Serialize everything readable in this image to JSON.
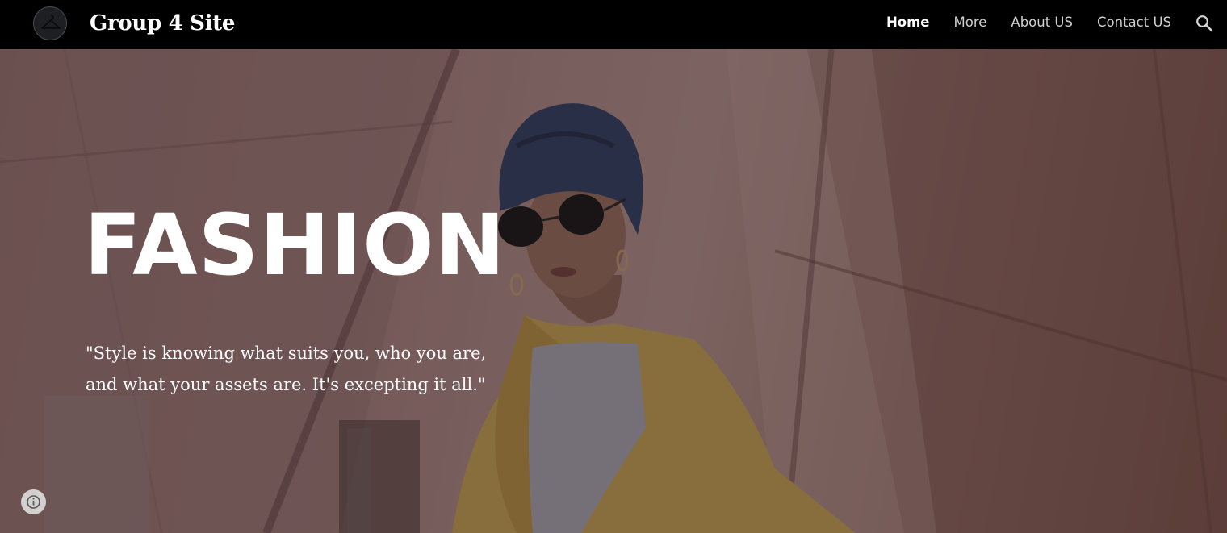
{
  "header": {
    "site_title": "Group 4 Site",
    "logo_icon": "clothes-hanger-icon",
    "nav": [
      {
        "label": "Home",
        "active": true
      },
      {
        "label": "More",
        "active": false
      },
      {
        "label": "About US",
        "active": false
      },
      {
        "label": "Contact US",
        "active": false
      }
    ],
    "search_icon": "search-icon"
  },
  "hero": {
    "title": "FASHION",
    "quote_line1": "\"Style is knowing what suits you, who you are,",
    "quote_line2": "and what your assets are. It's excepting it all.\""
  },
  "footer": {
    "info_icon": "info-icon"
  },
  "colors": {
    "header_bg": "#000000",
    "text_white": "#ffffff",
    "nav_inactive": "#cfcfcf",
    "hero_tint": "#9b7b7a"
  }
}
